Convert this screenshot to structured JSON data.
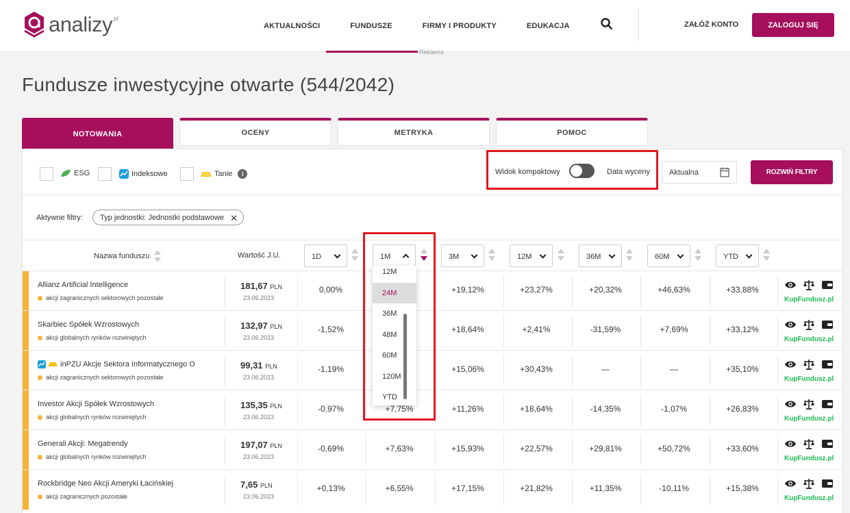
{
  "header": {
    "logo_text": "analizy",
    "logo_sup": "pl",
    "nav": [
      "AKTUALNOŚCI",
      "FUNDUSZE",
      "FIRMY I PRODUKTY",
      "EDUKACJA"
    ],
    "active_nav": "FUNDUSZE",
    "register": "ZAŁÓŻ KONTO",
    "login": "ZALOGUJ SIĘ",
    "ad_label": "Reklama"
  },
  "page_title": "Fundusze inwestycyjne otwarte (544/2042)",
  "tabs": [
    "NOTOWANIA",
    "OCENY",
    "METRYKA",
    "POMOC"
  ],
  "filters": {
    "esg": "ESG",
    "index": "Indeksowe",
    "cheap": "Tanie",
    "compact_view": "Widok kompaktowy",
    "valuation_date": "Data wyceny",
    "date_value": "Aktualna",
    "expand": "ROZWIŃ FILTRY",
    "active_label": "Aktywne filtry:",
    "chip": "Typ jednostki: Jednostki podstawowe"
  },
  "table": {
    "col_name": "Nazwa funduszu",
    "col_value": "Wartość J.U.",
    "periods": [
      "1D",
      "1M",
      "3M",
      "12M",
      "36M",
      "60M",
      "YTD"
    ],
    "dropdown_options": [
      "12M",
      "24M",
      "36M",
      "48M",
      "60M",
      "120M",
      "YTD"
    ],
    "dropdown_highlight": "24M",
    "buy_label": "KupFundusz.pl",
    "currency": "PLN",
    "rows": [
      {
        "name": "Allianz Artificial Intelligence",
        "category": "akcji zagranicznych sektorowych pozostałe",
        "price": "181,67",
        "date": "23.06.2023",
        "values": [
          "0,00%",
          "",
          "+19,12%",
          "+23,27%",
          "+20,32%",
          "+46,63%",
          "+33,88%"
        ]
      },
      {
        "name": "Skarbiec Spółek Wzrostowych",
        "category": "akcji globalnych rynków rozwiniętych",
        "price": "132,97",
        "date": "23.06.2023",
        "values": [
          "-1,52%",
          "",
          "+18,64%",
          "+2,41%",
          "-31,59%",
          "+7,69%",
          "+33,12%"
        ]
      },
      {
        "name": "inPZU Akcje Sektora Informatycznego O",
        "category": "akcji zagranicznych sektorowych pozostałe",
        "price": "99,31",
        "date": "23.06.2023",
        "values": [
          "-1,19%",
          "",
          "+15,06%",
          "+30,43%",
          "—",
          "—",
          "+35,10%"
        ]
      },
      {
        "name": "Investor Akcji Spółek Wzrostowych",
        "category": "akcji globalnych rynków rozwiniętych",
        "price": "135,35",
        "date": "23.06.2023",
        "values": [
          "-0,97%",
          "+7,75%",
          "+11,26%",
          "+18,64%",
          "-14,35%",
          "-1,07%",
          "+26,83%"
        ]
      },
      {
        "name": "Generali Akcji: Megatrendy",
        "category": "akcji globalnych rynków rozwiniętych",
        "price": "197,07",
        "date": "23.06.2023",
        "values": [
          "-0,69%",
          "+7,63%",
          "+15,93%",
          "+22,57%",
          "+29,81%",
          "+50,72%",
          "+33,60%"
        ]
      },
      {
        "name": "Rockbridge Neo Akcji Ameryki Łacińskiej",
        "category": "akcji zagranicznych pozostałe",
        "price": "7,65",
        "date": "23.06.2023",
        "values": [
          "+0,13%",
          "+6,55%",
          "+17,15%",
          "+21,82%",
          "+11,35%",
          "-10,11%",
          "+15,38%"
        ]
      }
    ]
  }
}
